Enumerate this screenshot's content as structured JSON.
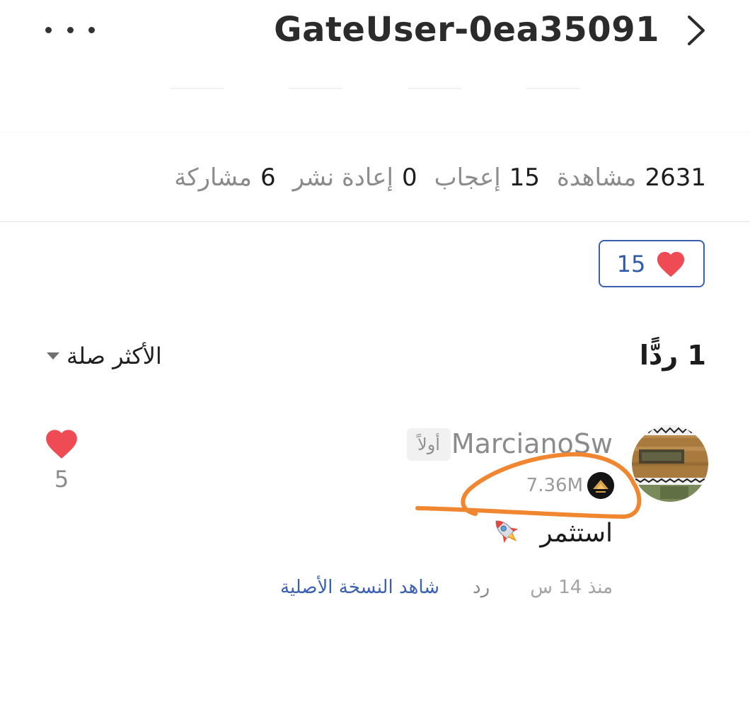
{
  "header": {
    "title": "GateUser-0ea35091",
    "more_icon": "more-horizontal-icon",
    "next_icon": "chevron-right-icon"
  },
  "stats": {
    "views_count": "2631",
    "views_label": "مشاهدة",
    "likes_count": "15",
    "likes_label": "إعجاب",
    "reposts_count": "0",
    "reposts_label": "إعادة نشر",
    "shares_count": "6",
    "shares_label": "مشاركة"
  },
  "like_button": {
    "count": "15",
    "icon": "heart-icon",
    "heart_color": "#ee4b55",
    "border_color": "#3a5fb0"
  },
  "replies": {
    "title": "1 ردًّا",
    "sort_label": "الأكثر صلة",
    "sort_icon": "caret-down-icon"
  },
  "comment": {
    "username": "MarcianoSw",
    "badge": "أولاً",
    "followers": "7.36M",
    "text": "استثمر",
    "emoji_icon": "rocket-icon",
    "time": "منذ 14 س",
    "reply_label": "رد",
    "view_original_label": "شاهد النسخة الأصلية",
    "like_count": "5",
    "link_color": "#3c61b0"
  },
  "annotation": {
    "color": "#f0862f"
  }
}
